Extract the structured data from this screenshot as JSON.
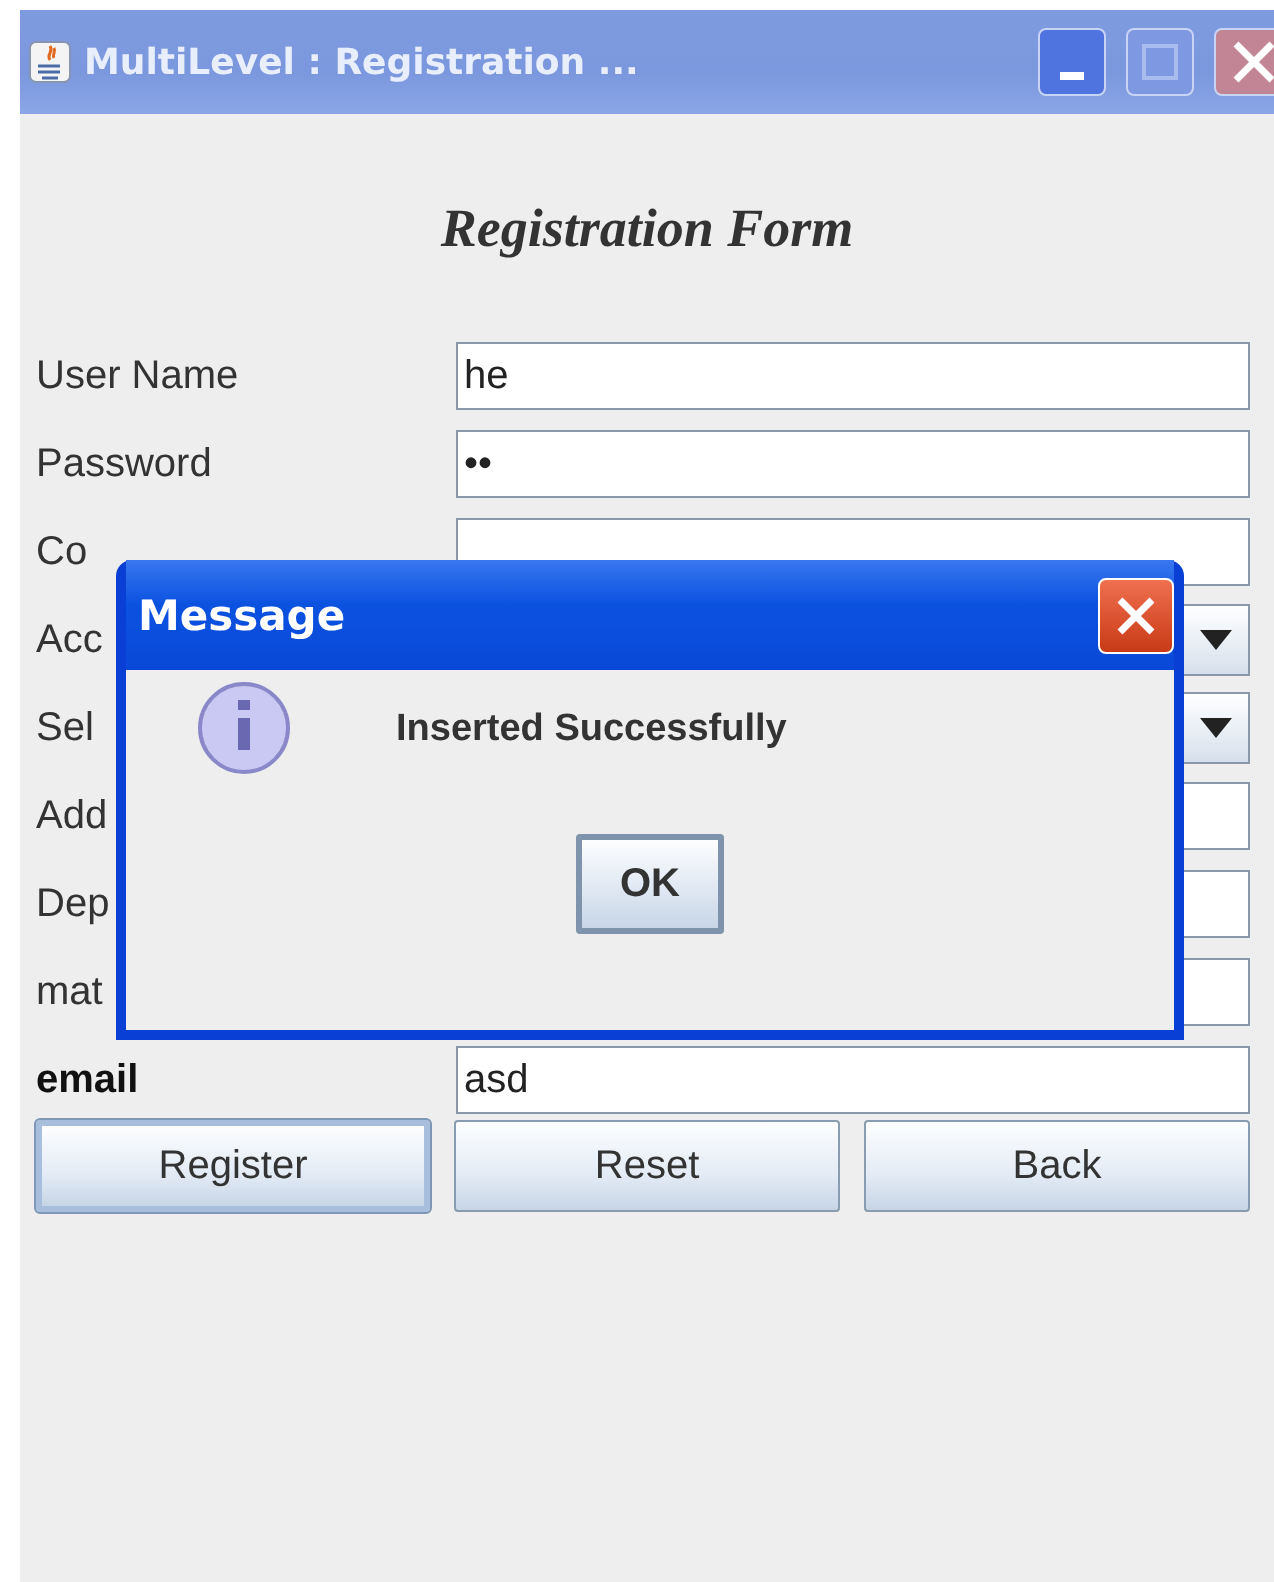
{
  "window": {
    "title": "MultiLevel : Registration ..."
  },
  "heading": "Registration Form",
  "fields": [
    {
      "label": "User Name",
      "kind": "text",
      "value": "he",
      "bold": false
    },
    {
      "label": "Password",
      "kind": "text",
      "value": "••",
      "bold": false
    },
    {
      "label": "Co",
      "kind": "text",
      "bold": false
    },
    {
      "label": "Acc",
      "kind": "combo",
      "bold": false
    },
    {
      "label": "Sel",
      "kind": "combo",
      "bold": false
    },
    {
      "label": "Add",
      "kind": "text",
      "bold": false
    },
    {
      "label": "Dep",
      "kind": "text",
      "bold": false
    },
    {
      "label": "mat",
      "kind": "text",
      "bold": false
    },
    {
      "label": "email",
      "kind": "text",
      "value": "asd",
      "bold": true
    }
  ],
  "buttons": [
    {
      "label": "Register",
      "focused": true
    },
    {
      "label": "Reset",
      "focused": false
    },
    {
      "label": "Back",
      "focused": false
    }
  ],
  "dialog": {
    "title": "Message",
    "message": "Inserted Successfully",
    "button": "OK"
  }
}
